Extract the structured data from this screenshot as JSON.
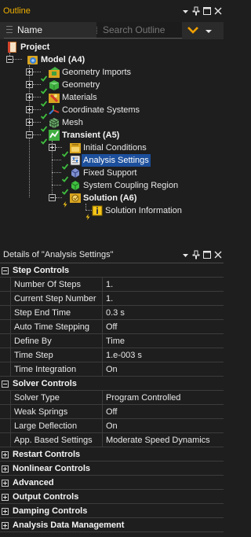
{
  "outline_panel": {
    "title": "Outline",
    "toolbar": {
      "name_column": "Name",
      "search_placeholder": "Search Outline"
    },
    "tree": {
      "project": "Project",
      "model": "Model (A4)",
      "geometry_imports": "Geometry Imports",
      "geometry": "Geometry",
      "materials": "Materials",
      "coordinate_systems": "Coordinate Systems",
      "mesh": "Mesh",
      "transient": "Transient (A5)",
      "initial_conditions": "Initial Conditions",
      "analysis_settings": "Analysis Settings",
      "fixed_support": "Fixed Support",
      "system_coupling_region": "System Coupling Region",
      "solution": "Solution (A6)",
      "solution_information": "Solution Information"
    }
  },
  "details_panel": {
    "title": "Details of \"Analysis Settings\"",
    "step_controls": {
      "label": "Step Controls",
      "rows": [
        {
          "name": "Number Of Steps",
          "value": "1."
        },
        {
          "name": "Current Step Number",
          "value": "1."
        },
        {
          "name": "Step End Time",
          "value": "0.3 s"
        },
        {
          "name": "Auto Time Stepping",
          "value": "Off"
        },
        {
          "name": "Define By",
          "value": "Time"
        },
        {
          "name": "Time Step",
          "value": "1.e-003 s"
        },
        {
          "name": "Time Integration",
          "value": "On"
        }
      ]
    },
    "solver_controls": {
      "label": "Solver Controls",
      "rows": [
        {
          "name": "Solver Type",
          "value": "Program Controlled"
        },
        {
          "name": "Weak Springs",
          "value": "Off"
        },
        {
          "name": "Large Deflection",
          "value": "On"
        },
        {
          "name": "App. Based Settings",
          "value": "Moderate Speed Dynamics"
        }
      ]
    },
    "collapsed_groups": [
      "Restart Controls",
      "Nonlinear Controls",
      "Advanced",
      "Output Controls",
      "Damping Controls",
      "Analysis Data Management"
    ]
  },
  "colors": {
    "panel_title": "#f0b000",
    "selection": "#1c4f9c",
    "check_green": "#3fbf3f",
    "lightning": "#f5c518"
  }
}
